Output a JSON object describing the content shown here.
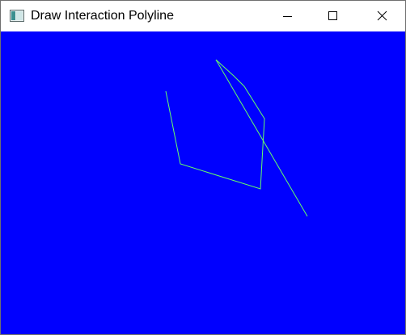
{
  "window": {
    "title": "Draw Interaction Polyline",
    "app_icon": "window-app-icon",
    "controls": {
      "minimize_icon": "minimize-icon",
      "maximize_icon": "maximize-icon",
      "close_icon": "close-icon"
    }
  },
  "canvas": {
    "background_color": "#0000ff",
    "polyline_color": "#66ff66"
  }
}
